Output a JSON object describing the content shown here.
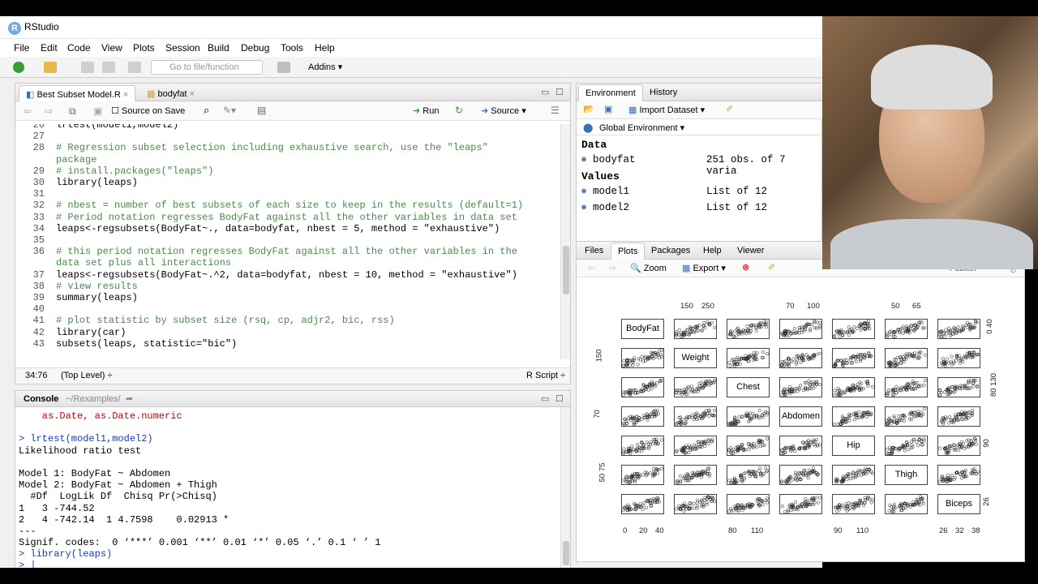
{
  "window": {
    "title": "RStudio"
  },
  "menubar": [
    "File",
    "Edit",
    "Code",
    "View",
    "Plots",
    "Session",
    "Build",
    "Debug",
    "Tools",
    "Help"
  ],
  "toolbar": {
    "goto_placeholder": "Go to file/function",
    "addins_label": "Addins"
  },
  "editor": {
    "tabs": [
      "Best Subset Model.R",
      "bodyfat"
    ],
    "source_on_save": "Source on Save",
    "run_label": "Run",
    "source_label": "Source",
    "lines": [
      {
        "n": "26",
        "t": "lrtest(model1,model2)",
        "c": false
      },
      {
        "n": "27",
        "t": "",
        "c": false
      },
      {
        "n": "28",
        "t": "# Regression subset selection including exhaustive search, use the \"leaps\"",
        "c": true
      },
      {
        "n": "",
        "t": "package",
        "c": true
      },
      {
        "n": "29",
        "t": "# install.packages(\"leaps\")",
        "c": true
      },
      {
        "n": "30",
        "t": "library(leaps)",
        "c": false
      },
      {
        "n": "31",
        "t": "",
        "c": false
      },
      {
        "n": "32",
        "t": "# nbest = number of best subsets of each size to keep in the results (default=1)",
        "c": true
      },
      {
        "n": "33",
        "t": "# Period notation regresses BodyFat against all the other variables in data set",
        "c": true
      },
      {
        "n": "34",
        "t": "leaps<-regsubsets(BodyFat~., data=bodyfat, nbest = 5, method = \"exhaustive\")",
        "c": false
      },
      {
        "n": "35",
        "t": "",
        "c": false
      },
      {
        "n": "36",
        "t": "# this period notation regresses BodyFat against all the other variables in the",
        "c": true
      },
      {
        "n": "",
        "t": "data set plus all interactions",
        "c": true
      },
      {
        "n": "37",
        "t": "leaps<-regsubsets(BodyFat~.^2, data=bodyfat, nbest = 10, method = \"exhaustive\")",
        "c": false
      },
      {
        "n": "38",
        "t": "# view results",
        "c": true
      },
      {
        "n": "39",
        "t": "summary(leaps)",
        "c": false
      },
      {
        "n": "40",
        "t": "",
        "c": false
      },
      {
        "n": "41",
        "t": "# plot statistic by subset size (rsq, cp, adjr2, bic, rss)",
        "c": true
      },
      {
        "n": "42",
        "t": "library(car)",
        "c": false
      },
      {
        "n": "43",
        "t": "subsets(leaps, statistic=\"bic\")",
        "c": false
      }
    ],
    "status_pos": "34:76",
    "status_scope": "(Top Level) ÷",
    "status_type": "R Script ÷"
  },
  "console": {
    "title": "Console",
    "path": "~/Rexamples/",
    "lines": [
      {
        "t": "    as.Date, as.Date.numeric",
        "k": "red"
      },
      {
        "t": "",
        "k": ""
      },
      {
        "t": "> lrtest(model1,model2)",
        "k": "blue"
      },
      {
        "t": "Likelihood ratio test",
        "k": ""
      },
      {
        "t": "",
        "k": ""
      },
      {
        "t": "Model 1: BodyFat ~ Abdomen",
        "k": ""
      },
      {
        "t": "Model 2: BodyFat ~ Abdomen + Thigh",
        "k": ""
      },
      {
        "t": "  #Df  LogLik Df  Chisq Pr(>Chisq)",
        "k": ""
      },
      {
        "t": "1   3 -744.52",
        "k": ""
      },
      {
        "t": "2   4 -742.14  1 4.7598    0.02913 *",
        "k": ""
      },
      {
        "t": "---",
        "k": ""
      },
      {
        "t": "Signif. codes:  0 ‘***’ 0.001 ‘**’ 0.01 ‘*’ 0.05 ‘.’ 0.1 ‘ ’ 1",
        "k": ""
      },
      {
        "t": "> library(leaps)",
        "k": "blue"
      },
      {
        "t": "> |",
        "k": "blue"
      }
    ]
  },
  "environment": {
    "tabs": [
      "Environment",
      "History"
    ],
    "import_label": "Import Dataset",
    "global_env": "Global Environment",
    "data_header": "Data",
    "values_header": "Values",
    "data": [
      {
        "name": "bodyfat",
        "value": "251 obs. of 7 varia"
      }
    ],
    "values": [
      {
        "name": "model1",
        "value": "List of 12"
      },
      {
        "name": "model2",
        "value": "List of 12"
      }
    ]
  },
  "plots": {
    "tabs": [
      "Files",
      "Plots",
      "Packages",
      "Help",
      "Viewer"
    ],
    "zoom_label": "Zoom",
    "export_label": "Export",
    "publish_label": "Publish",
    "variables": [
      "BodyFat",
      "Weight",
      "Chest",
      "Abdomen",
      "Hip",
      "Thigh",
      "Biceps"
    ],
    "top_ticks": [
      {
        "col": 1,
        "labels": [
          "150",
          "250"
        ]
      },
      {
        "col": 3,
        "labels": [
          "70",
          "100"
        ]
      },
      {
        "col": 5,
        "labels": [
          "50",
          "65"
        ]
      }
    ],
    "bottom_ticks": [
      {
        "col": 0,
        "labels": [
          "0",
          "20",
          "40"
        ]
      },
      {
        "col": 2,
        "labels": [
          "80",
          "110"
        ]
      },
      {
        "col": 4,
        "labels": [
          "90",
          "110"
        ]
      },
      {
        "col": 6,
        "labels": [
          "26",
          "32",
          "38"
        ]
      }
    ],
    "left_ticks": [
      {
        "row": 1,
        "label": "150"
      },
      {
        "row": 3,
        "label": "70"
      },
      {
        "row": 5,
        "label": "50  75"
      }
    ],
    "right_ticks": [
      {
        "row": 0,
        "label": "0  40"
      },
      {
        "row": 2,
        "label": "80  130"
      },
      {
        "row": 4,
        "label": "90"
      },
      {
        "row": 6,
        "label": "26"
      }
    ]
  }
}
